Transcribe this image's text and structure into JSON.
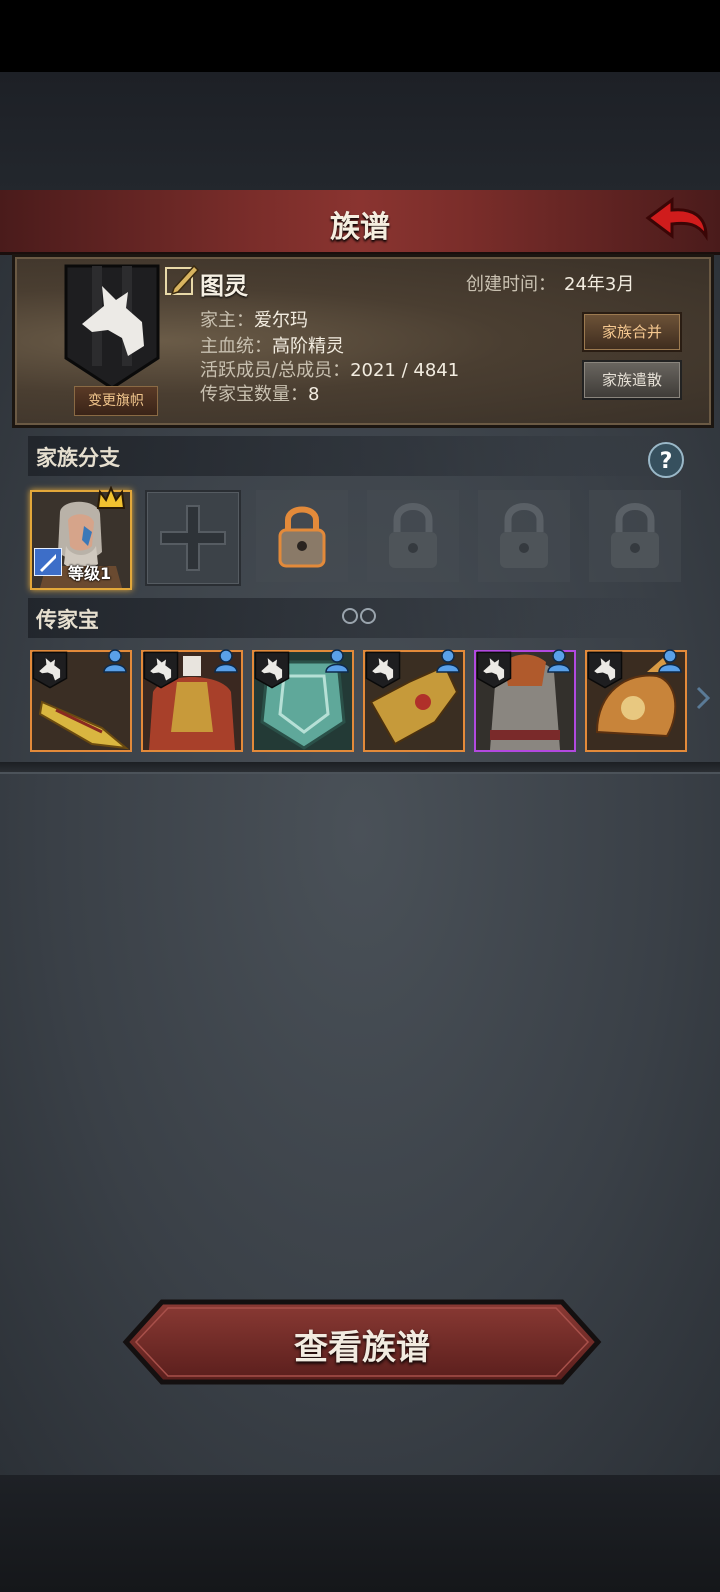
{
  "header": {
    "title": "族谱"
  },
  "clan": {
    "name": "图灵",
    "created_label": "创建时间：",
    "created_value": "24年3月",
    "leader_label": "家主：",
    "leader_value": "爱尔玛",
    "bloodline_label": "主血统：",
    "bloodline_value": "高阶精灵",
    "members_label": "活跃成员/总成员：",
    "members_value": "2021 / 4841",
    "heirloom_count_label": "传家宝数量：",
    "heirloom_count_value": "8",
    "change_flag_label": "变更旗帜",
    "merge_label": "家族合并",
    "disband_label": "家族遣散"
  },
  "branches": {
    "title": "家族分支",
    "leader_level": "等级1"
  },
  "heirlooms": {
    "title": "传家宝",
    "items": [
      {
        "icon": "golden-sword",
        "rarity": "orange"
      },
      {
        "icon": "red-armor",
        "rarity": "orange"
      },
      {
        "icon": "jade-shield",
        "rarity": "orange"
      },
      {
        "icon": "golden-gauntlet",
        "rarity": "orange"
      },
      {
        "icon": "chainmail-armor",
        "rarity": "purple"
      },
      {
        "icon": "dragon-amulet",
        "rarity": "orange"
      }
    ]
  },
  "footer": {
    "view_button": "查看族谱"
  },
  "colors": {
    "accent": "#e38a3a",
    "title_red": "#8a3430",
    "epic": "#b249e0"
  }
}
